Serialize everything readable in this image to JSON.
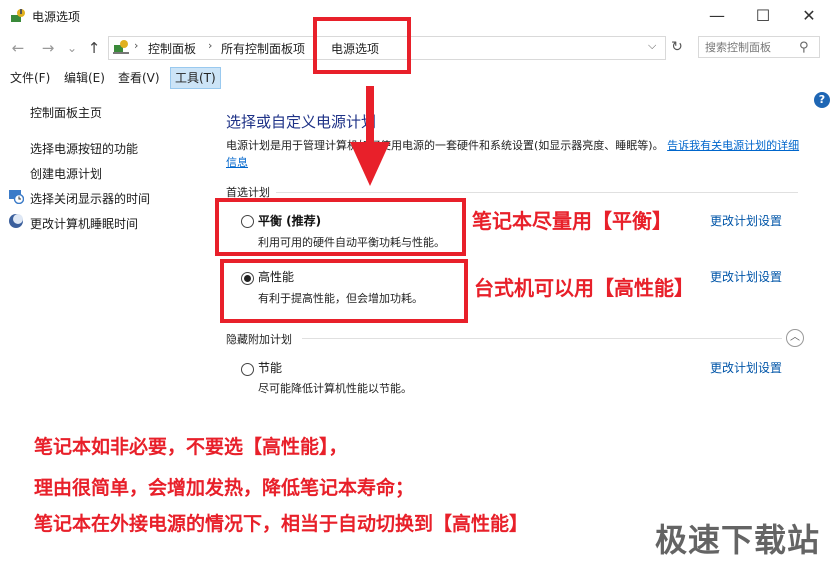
{
  "window": {
    "title": "电源选项",
    "minimize_glyph": "—",
    "maximize_glyph": "☐",
    "close_glyph": "✕"
  },
  "nav": {
    "back_glyph": "←",
    "forward_glyph": "→",
    "recent_glyph": "⌄",
    "up_glyph": "↑",
    "breadcrumb": [
      "控制面板",
      "所有控制面板项",
      "电源选项"
    ],
    "search_placeholder": "搜索控制面板"
  },
  "menu": [
    "文件(F)",
    "编辑(E)",
    "查看(V)",
    "工具(T)"
  ],
  "sidebar": {
    "home": "控制面板主页",
    "links": [
      "选择电源按钮的功能",
      "创建电源计划",
      "选择关闭显示器的时间",
      "更改计算机睡眠时间"
    ]
  },
  "main": {
    "title": "选择或自定义电源计划",
    "desc_text": "电源计划是用于管理计算机如何使用电源的一套硬件和系统设置(如显示器亮度、睡眠等)。",
    "desc_link": "告诉我有关电源计划的详细信息",
    "preferred_label": "首选计划",
    "hidden_label": "隐藏附加计划",
    "change_link": "更改计划设置",
    "plans": [
      {
        "name": "平衡 (推荐)",
        "desc": "利用可用的硬件自动平衡功耗与性能。",
        "selected": false
      },
      {
        "name": "高性能",
        "desc": "有利于提高性能，但会增加功耗。",
        "selected": true
      },
      {
        "name": "节能",
        "desc": "尽可能降低计算机性能以节能。",
        "selected": false
      }
    ]
  },
  "annotations": {
    "balanced": "笔记本尽量用【平衡】",
    "performance": "台式机可以用【高性能】",
    "note_lines": [
      "笔记本如非必要，不要选【高性能】，",
      "理由很简单，会增加发热，降低笔记本寿命；",
      "笔记本在外接电源的情况下，相当于自动切换到【高性能】"
    ]
  },
  "watermark": "极速下载站",
  "colors": {
    "accent_red": "#e8202a",
    "title_blue": "#1e3287",
    "link_blue": "#0066cc"
  }
}
